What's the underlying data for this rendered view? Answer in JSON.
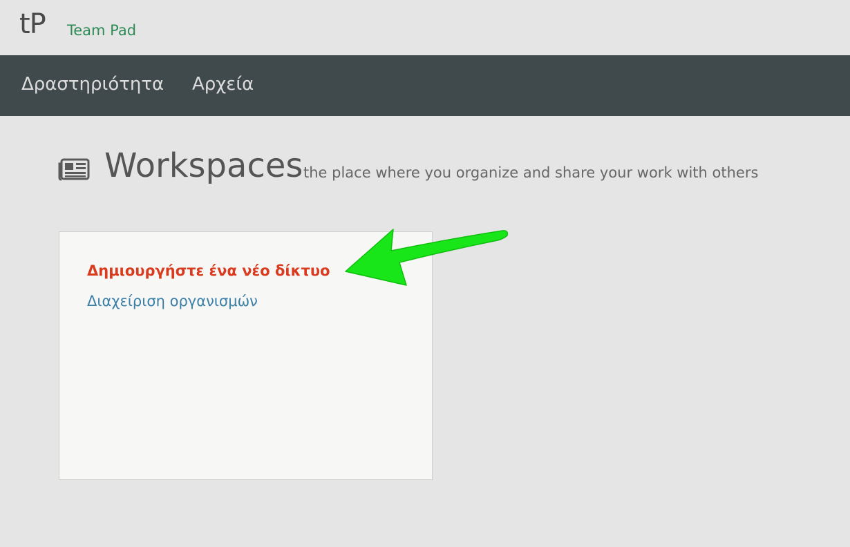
{
  "header": {
    "logo": "tP",
    "app_name": "Team Pad"
  },
  "nav": {
    "items": [
      {
        "label": "Δραστηριότητα"
      },
      {
        "label": "Αρχεία"
      }
    ]
  },
  "page": {
    "icon": "newspaper-icon",
    "title": "Workspaces",
    "subtitle": "the place where you organize and share your work with others"
  },
  "card": {
    "links": [
      {
        "label": "Δημιουργήστε ένα νέο δίκτυο",
        "color": "#d93b1f"
      },
      {
        "label": "Διαχείριση οργανισμών",
        "color": "#3a7fa8"
      }
    ]
  },
  "annotation": {
    "icon": "arrow-icon",
    "color": "#19e619"
  }
}
